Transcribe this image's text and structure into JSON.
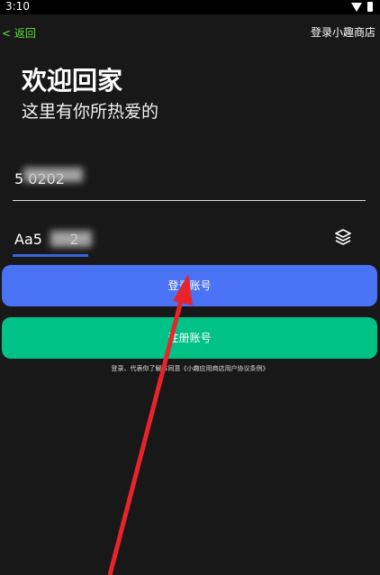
{
  "status": {
    "time": "3:10"
  },
  "header": {
    "back_label": "< 返回",
    "title": "登录小趣商店"
  },
  "welcome": {
    "title": "欢迎回家",
    "subtitle": "这里有你所热爱的"
  },
  "form": {
    "account_value": "5 0202",
    "password_value": "Aa5      2"
  },
  "buttons": {
    "login": "登录账号",
    "register": "注册账号"
  },
  "agreement": "登录、代表你了解并同意《小趣应用商店用户协议条例》",
  "colors": {
    "login": "#4a72f5",
    "register": "#00c286",
    "back": "#5fe03a",
    "arrow": "#e8242a"
  }
}
